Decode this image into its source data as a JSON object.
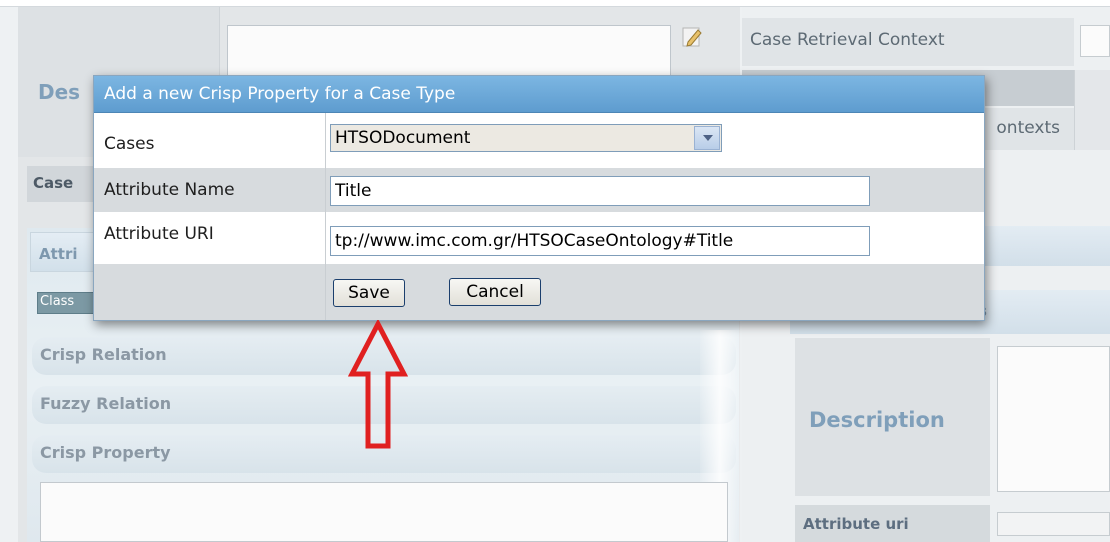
{
  "background": {
    "left_panel": {
      "description_heading": "Des",
      "case_label": "Case",
      "accordion_header": "Attri",
      "class_cell": "Class",
      "accordion_items": [
        "Crisp Relation",
        "Fuzzy Relation",
        "Crisp Property"
      ]
    },
    "right_panel": {
      "case_retrieval_context": "Case Retrieval Context",
      "contexts_partial": "ontexts",
      "section_partial": "s",
      "description_heading": "Description",
      "attribute_uri_label": "Attribute uri"
    }
  },
  "dialog": {
    "title": "Add a new Crisp Property for a Case Type",
    "fields": {
      "cases_label": "Cases",
      "cases_selected": "HTSODocument",
      "attribute_name_label": "Attribute Name",
      "attribute_name_value": "Title",
      "attribute_uri_label": "Attribute URI",
      "attribute_uri_value": "tp://www.imc.com.gr/HTSOCaseOntology#Title"
    },
    "buttons": {
      "save": "Save",
      "cancel": "Cancel"
    }
  },
  "colors": {
    "dialog_title_bg": "#6aa8d8",
    "annotation_arrow": "#e02020",
    "row_grey": "#d7dbde"
  }
}
